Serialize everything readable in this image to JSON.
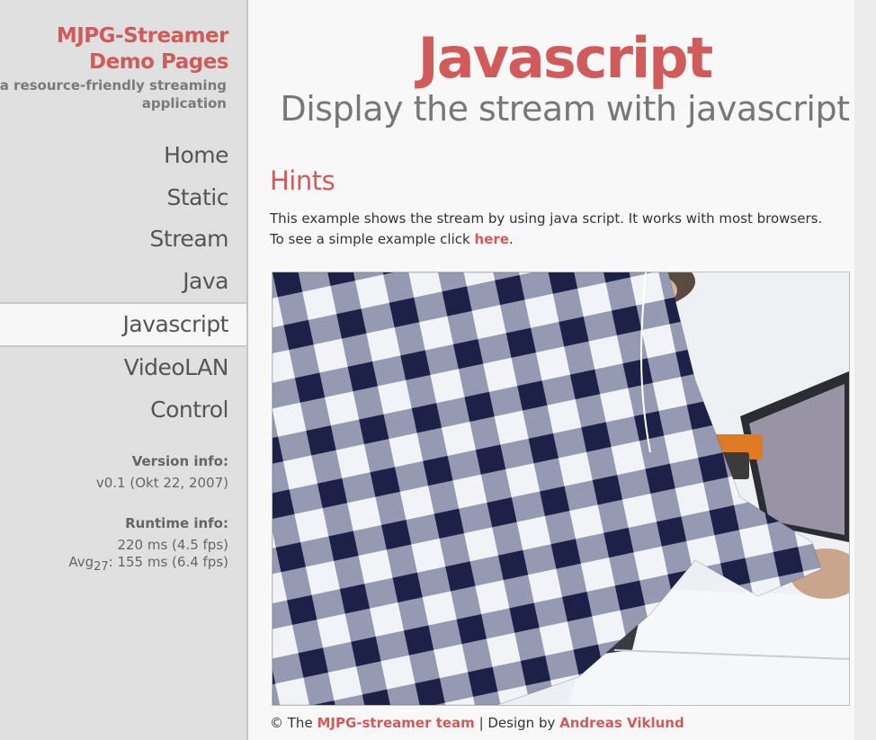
{
  "brand": {
    "title_line1": "MJPG-Streamer",
    "title_line2": "Demo Pages",
    "tagline": "a resource-friendly streaming application"
  },
  "nav": {
    "items": [
      {
        "label": "Home"
      },
      {
        "label": "Static"
      },
      {
        "label": "Stream"
      },
      {
        "label": "Java"
      },
      {
        "label": "Javascript"
      },
      {
        "label": "VideoLAN"
      },
      {
        "label": "Control"
      }
    ],
    "active": "Javascript"
  },
  "version": {
    "heading": "Version info:",
    "value": "v0.1 (Okt 22, 2007)"
  },
  "runtime": {
    "heading": "Runtime info:",
    "line1": "220 ms (4.5 fps)",
    "avg_label": "Avg",
    "avg_sub": "27",
    "avg_value": ": 155 ms (6.4 fps)"
  },
  "main": {
    "title": "Javascript",
    "subtitle": "Display the stream with javascript",
    "hints_heading": "Hints",
    "hint_line1": "This example shows the stream by using java script. It works with most browsers.",
    "hint_line2_prefix": "To see a simple example click ",
    "hint_link": "here",
    "hint_line2_suffix": "."
  },
  "footer": {
    "prefix": "© The ",
    "team_link": "MJPG-streamer team",
    "middle": " | Design by ",
    "designer_link": "Andreas Viklund"
  },
  "colors": {
    "accent": "#d15b5b",
    "sidebar_bg": "#e0e0e0",
    "main_bg": "#f8f8f8",
    "text_gray": "#777777"
  }
}
